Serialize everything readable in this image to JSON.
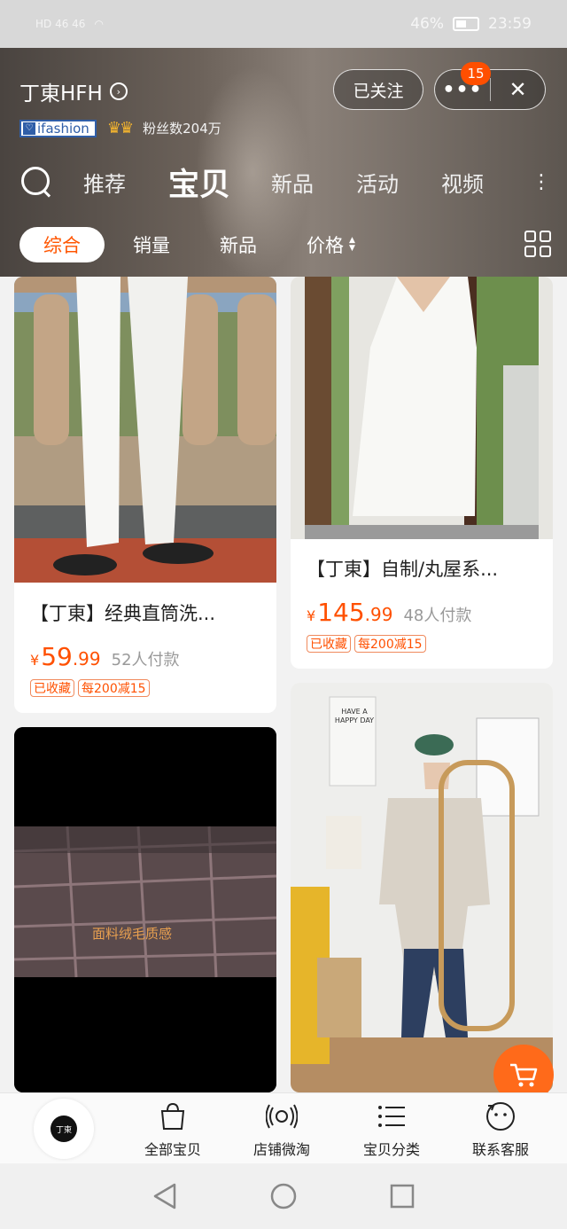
{
  "status_bar": {
    "network_left": "HD 46 46",
    "battery": "46%",
    "time": "23:59"
  },
  "shop": {
    "name": "丁東HFH",
    "ifashion_label": "ifashion",
    "fans": "粉丝数204万",
    "follow_label": "已关注",
    "more_label": "•••",
    "notif_count": "15",
    "close_label": "✕"
  },
  "nav": {
    "tabs": [
      "推荐",
      "宝贝",
      "新品",
      "活动",
      "视频"
    ],
    "active_tab": "宝贝",
    "more": "⋮"
  },
  "filters": {
    "items": [
      "综合",
      "销量",
      "新品",
      "价格"
    ],
    "active": "综合"
  },
  "products": [
    {
      "title": "【丁東】经典直筒洗...",
      "currency": "¥",
      "price_int": "59",
      "price_dec": ".99",
      "sales": "52人付款",
      "tags": [
        "已收藏",
        "每200减15"
      ]
    },
    {
      "title": "【丁東】自制/丸屋系...",
      "currency": "¥",
      "price_int": "145",
      "price_dec": ".99",
      "sales": "48人付款",
      "tags": [
        "已收藏",
        "每200减15"
      ]
    },
    {
      "overlay_text": "面料绒毛质感"
    },
    {
      "poster_text": "HAVE A HAPPY DAY"
    }
  ],
  "bottom_bar": {
    "logo_text": "丁東",
    "items": [
      "全部宝贝",
      "店铺微淘",
      "宝贝分类",
      "联系客服"
    ]
  },
  "colors": {
    "accent": "#ff5000",
    "tag_border": "#f08a5d"
  }
}
